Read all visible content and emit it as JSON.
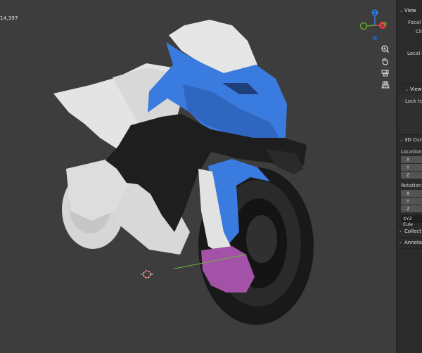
{
  "viewport": {
    "stats_text": "14,397",
    "gizmo": {
      "z_label": "Z",
      "x_label": "X",
      "z_color": "#2e7de8",
      "x_color": "#e8384a",
      "y_color": "#64a52b"
    },
    "nav_icons": [
      "zoom-icon",
      "hand-pan-icon",
      "camera-icon",
      "perspective-grid-icon"
    ]
  },
  "sidebar": {
    "view_header": "View",
    "focal_label": "Focal L",
    "clip_label": "Clip",
    "local_camera_label": "Local C",
    "view_lock_header": "View",
    "lock_label": "Lock to",
    "cursor_header": "3D Curs",
    "location_label": "Location:",
    "rotation_label": "Rotation:",
    "axes": [
      "X",
      "Y",
      "Z"
    ],
    "rotation_mode": "XYZ Eule",
    "collections_header": "Collect",
    "annotations_header": "Annota"
  },
  "colors": {
    "background": "#3d3d3d",
    "body_white": "#e3e3e3",
    "fairing_blue": "#3a7be0",
    "fender_magenta": "#a451a8",
    "tire_black": "#1c1c1c"
  }
}
